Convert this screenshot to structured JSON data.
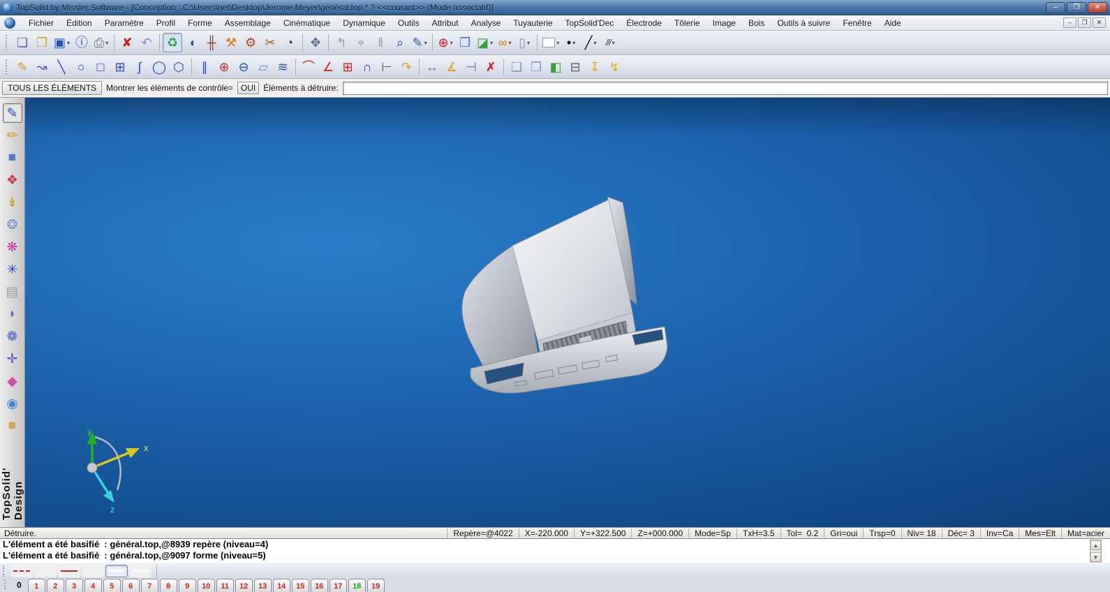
{
  "window": {
    "title": "TopSolid by Missler Software - [Conception : C:\\Users\\net\\Desktop\\Jerome Meyer\\général.top * ?  <<courant>> (Mode associatif)]",
    "controls": [
      {
        "name": "minimize",
        "glyph": "–"
      },
      {
        "name": "restore",
        "glyph": "❐"
      },
      {
        "name": "close",
        "glyph": "✕"
      }
    ]
  },
  "menu": {
    "items": [
      "Fichier",
      "Édition",
      "Paramètre",
      "Profil",
      "Forme",
      "Assemblage",
      "Cinématique",
      "Dynamique",
      "Outils",
      "Attribut",
      "Analyse",
      "Tuyauterie",
      "TopSolid'Dec",
      "Électrode",
      "Tôlerie",
      "Image",
      "Bois",
      "Outils à suivre",
      "Fenêtre",
      "Aide"
    ]
  },
  "toolbar_main": {
    "items": [
      {
        "name": "new-document",
        "glyph": "❏",
        "color": "#4a6fae"
      },
      {
        "name": "open-document",
        "glyph": "❒",
        "color": "#d9a520"
      },
      {
        "name": "save-document",
        "glyph": "▣",
        "color": "#2050c8",
        "dropdown": true
      },
      {
        "name": "document-info",
        "glyph": "ⓘ",
        "color": "#1648c8"
      },
      {
        "name": "print",
        "glyph": "⎙",
        "color": "#6f7e90",
        "dropdown": true
      },
      {
        "type": "sep"
      },
      {
        "name": "delete-element",
        "glyph": "✘",
        "color": "#d41a1a"
      },
      {
        "name": "undo",
        "glyph": "↶",
        "color": "#7d93c9"
      },
      {
        "type": "sep"
      },
      {
        "name": "destroy-elements",
        "glyph": "♻",
        "color": "#2f9e3f",
        "selected": true
      },
      {
        "name": "modify-element",
        "glyph": "◖",
        "color": "#2a52be"
      },
      {
        "name": "element-attributes",
        "glyph": "╫",
        "color": "#7a4a28"
      },
      {
        "name": "hammer-tool",
        "glyph": "⚒",
        "color": "#e07818"
      },
      {
        "name": "bend-tool",
        "glyph": "⚙",
        "color": "#c34418"
      },
      {
        "name": "smash-tool",
        "glyph": "✂",
        "color": "#a85a20"
      },
      {
        "name": "shade-mode",
        "glyph": "◔",
        "color": "#2f3550"
      },
      {
        "type": "sep"
      },
      {
        "name": "axis-orientation",
        "glyph": "✥",
        "color": "#5a6a90"
      },
      {
        "type": "sep"
      },
      {
        "name": "dynamic-rotate",
        "glyph": "↰",
        "color": "#9aa0aa"
      },
      {
        "name": "dynamic-target",
        "glyph": "⌖",
        "color": "#9aa0aa"
      },
      {
        "name": "dynamic-sliders",
        "glyph": "‖",
        "color": "#9aa0aa"
      },
      {
        "name": "magnifier-loop",
        "glyph": "⌕",
        "color": "#2a52be"
      },
      {
        "name": "annotate-pen",
        "glyph": "✎",
        "color": "#3858b8",
        "dropdown": true
      },
      {
        "type": "sep"
      },
      {
        "name": "zoom-in",
        "glyph": "⊕",
        "color": "#cc2222",
        "dropdown": true
      },
      {
        "name": "zoom-fit",
        "glyph": "❐",
        "color": "#3b6fd4"
      },
      {
        "name": "render-image",
        "glyph": "◪",
        "color": "#3f9e3f",
        "dropdown": true
      },
      {
        "name": "view-glasses",
        "glyph": "∞",
        "color": "#e07818",
        "dropdown": true
      },
      {
        "name": "material-column",
        "glyph": "▯",
        "color": "#8898b0",
        "dropdown": true
      },
      {
        "type": "sep"
      },
      {
        "name": "color-current",
        "glyph": "",
        "color": "#ffffff",
        "cls": "swatch",
        "dropdown": true
      },
      {
        "name": "point-style",
        "glyph": "•",
        "color": "#111111",
        "dropdown": true
      },
      {
        "name": "line-type",
        "glyph": "╱",
        "color": "#111111",
        "dropdown": true
      },
      {
        "name": "hatch-style",
        "glyph": "///",
        "color": "#333333",
        "cls": "small-glyph",
        "dropdown": true
      }
    ]
  },
  "toolbar_sketch": {
    "items": [
      {
        "name": "sketch-contour",
        "glyph": "✎",
        "color": "#d99a1f"
      },
      {
        "name": "polyline",
        "glyph": "↝",
        "color": "#4a55c0"
      },
      {
        "name": "line-segment",
        "glyph": "╲",
        "color": "#2847c8"
      },
      {
        "name": "circle-center",
        "glyph": "○",
        "color": "#2847c8"
      },
      {
        "name": "rectangle",
        "glyph": "□",
        "color": "#2847c8"
      },
      {
        "name": "rectangle-axes",
        "glyph": "⊞",
        "color": "#2847c8"
      },
      {
        "name": "spline",
        "glyph": "∫",
        "color": "#2847c8"
      },
      {
        "name": "ellipse",
        "glyph": "◯",
        "color": "#2847c8"
      },
      {
        "name": "polygon",
        "glyph": "⬡",
        "color": "#2847c8"
      },
      {
        "type": "sep"
      },
      {
        "name": "parallel-curve",
        "glyph": "∥",
        "color": "#2847c8"
      },
      {
        "name": "point",
        "glyph": "⊕",
        "color": "#cc3030"
      },
      {
        "name": "slot-oblong",
        "glyph": "⊖",
        "color": "#2847c8"
      },
      {
        "name": "planar-face",
        "glyph": "▱",
        "color": "#7688c8"
      },
      {
        "name": "sweep-surface",
        "glyph": "≋",
        "color": "#2a52be"
      },
      {
        "type": "sep"
      },
      {
        "name": "corner-fillet",
        "glyph": "⌒",
        "color": "#cc2222"
      },
      {
        "name": "corner-chamfer",
        "glyph": "∠",
        "color": "#cc2222"
      },
      {
        "name": "boolean-merge",
        "glyph": "⊞",
        "color": "#cc2222"
      },
      {
        "name": "trim-curve",
        "glyph": "∩",
        "color": "#2847c8"
      },
      {
        "name": "limit-extend",
        "glyph": "⊢",
        "color": "#556070"
      },
      {
        "name": "orient-curve",
        "glyph": "↷",
        "color": "#e0a020"
      },
      {
        "type": "sep"
      },
      {
        "name": "measure-distance",
        "glyph": "↔",
        "color": "#5577bb"
      },
      {
        "name": "measure-angle",
        "glyph": "∡",
        "color": "#e0a020"
      },
      {
        "name": "dimension",
        "glyph": "⊣",
        "color": "#5577bb"
      },
      {
        "name": "delete-operation",
        "glyph": "✗",
        "color": "#dd1111"
      },
      {
        "type": "sep"
      },
      {
        "name": "view-standard",
        "glyph": "❑",
        "color": "#7e97c8"
      },
      {
        "name": "view-under",
        "glyph": "❒",
        "color": "#7e97c8"
      },
      {
        "name": "view-section",
        "glyph": "◧",
        "color": "#3f9e3f"
      },
      {
        "name": "view-clip",
        "glyph": "⊟",
        "color": "#556070"
      },
      {
        "name": "drop-vertical",
        "glyph": "↧",
        "color": "#e0b020"
      },
      {
        "name": "drop-zigzag",
        "glyph": "↯",
        "color": "#e0b020"
      }
    ]
  },
  "control_bar": {
    "all_elements_button": "TOUS LES ÉLÉMENTS",
    "show_control_label": "Montrer les éléments de contrôle=",
    "show_control_value": "OUI",
    "destroy_label": "Éléments à détruire:",
    "destroy_value": ""
  },
  "sidebar": {
    "brand": "TopSolid' Design",
    "items": [
      {
        "name": "sketch-mode",
        "glyph": "✎",
        "color": "#2050c8",
        "selected": true
      },
      {
        "name": "surface-pen",
        "glyph": "✏",
        "color": "#caa018"
      },
      {
        "name": "solid-primitive",
        "glyph": "■",
        "color": "#5a78c8"
      },
      {
        "name": "shape-surface",
        "glyph": "❖",
        "color": "#cc3344"
      },
      {
        "name": "drill-operation",
        "glyph": "↡",
        "color": "#caa018"
      },
      {
        "name": "circular-pattern",
        "glyph": "❂",
        "color": "#8090c8"
      },
      {
        "name": "palette-attributes",
        "glyph": "❋",
        "color": "#c040a0"
      },
      {
        "name": "dynamic-star",
        "glyph": "✳",
        "color": "#2050c8"
      },
      {
        "name": "extrude-profile",
        "glyph": "▤",
        "color": "#9aa0aa"
      },
      {
        "name": "curved-surface",
        "glyph": "◗",
        "color": "#8060c0"
      },
      {
        "name": "swirl-surface",
        "glyph": "❁",
        "color": "#4a55c0"
      },
      {
        "name": "plane-definition",
        "glyph": "✛",
        "color": "#4a55c0"
      },
      {
        "name": "folded-surface",
        "glyph": "◆",
        "color": "#d050a0"
      },
      {
        "name": "render-sphere",
        "glyph": "◉",
        "color": "#4888d0"
      },
      {
        "name": "wood-material",
        "glyph": "■",
        "color": "#d2a35c"
      }
    ]
  },
  "viewport": {
    "model": "truck-hood-3d-model",
    "axis_labels": {
      "x": "x",
      "y": "y",
      "z": "z"
    },
    "axis_colors": {
      "x": "#e8e13a",
      "y": "#35d035",
      "z": "#3ae0e8"
    }
  },
  "status_bar": {
    "command": "Détruire.",
    "fields": [
      {
        "name": "repere",
        "text": "Repère=@4022"
      },
      {
        "name": "x",
        "text": "X=-220.000"
      },
      {
        "name": "y",
        "text": "Y=+322.500"
      },
      {
        "name": "z",
        "text": "Z=+000.000"
      },
      {
        "name": "mode",
        "text": "Mode=Sp"
      },
      {
        "name": "txh",
        "text": "TxH=3.5"
      },
      {
        "name": "tol",
        "text": "Tol=  0.2"
      },
      {
        "name": "gri",
        "text": "Gri=oui"
      },
      {
        "name": "trsp",
        "text": "Trsp=0"
      },
      {
        "name": "niv",
        "text": "Niv= 18"
      },
      {
        "name": "dec",
        "text": "Déc= 3"
      },
      {
        "name": "inv",
        "text": "Inv=Ca"
      },
      {
        "name": "mes",
        "text": "Mes=Elt"
      },
      {
        "name": "mat",
        "text": "Mat=acier"
      }
    ]
  },
  "log": {
    "lines": [
      "L'élément a été basifié  : général.top,@8939 repère (niveau=4)",
      "L'élément a été basifié  : général.top,@9097 forme (niveau=5)"
    ]
  },
  "linestyle_bar": {
    "items": [
      {
        "name": "linestyle-dashdot-red",
        "style": "dashdot"
      },
      {
        "name": "linestyle-thin-light",
        "style": "thin"
      },
      {
        "name": "linestyle-solid-red",
        "style": "red"
      },
      {
        "name": "linestyle-light",
        "style": "light"
      },
      {
        "name": "linestyle-white-thick",
        "style": "white",
        "selected": true
      },
      {
        "name": "linestyle-white",
        "style": "white2"
      }
    ]
  },
  "level_bar": {
    "prefix": "0",
    "active": "18",
    "buttons": [
      "1",
      "2",
      "3",
      "4",
      "5",
      "6",
      "7",
      "8",
      "9",
      "10",
      "11",
      "12",
      "13",
      "14",
      "15",
      "16",
      "17",
      "18",
      "19"
    ]
  },
  "glyphs": {
    "dropdown": "▾",
    "scroll_up": "▲",
    "scroll_down": "▼"
  },
  "colors": {
    "viewport_top": "#2b7dca",
    "viewport_mid": "#1a5fa8",
    "viewport_bottom": "#0b3a70",
    "level_active": "#0faf0f",
    "level_inactive": "#cc2222",
    "titlebar": "#4a76a8",
    "model_silver": "#d8dbe0"
  }
}
